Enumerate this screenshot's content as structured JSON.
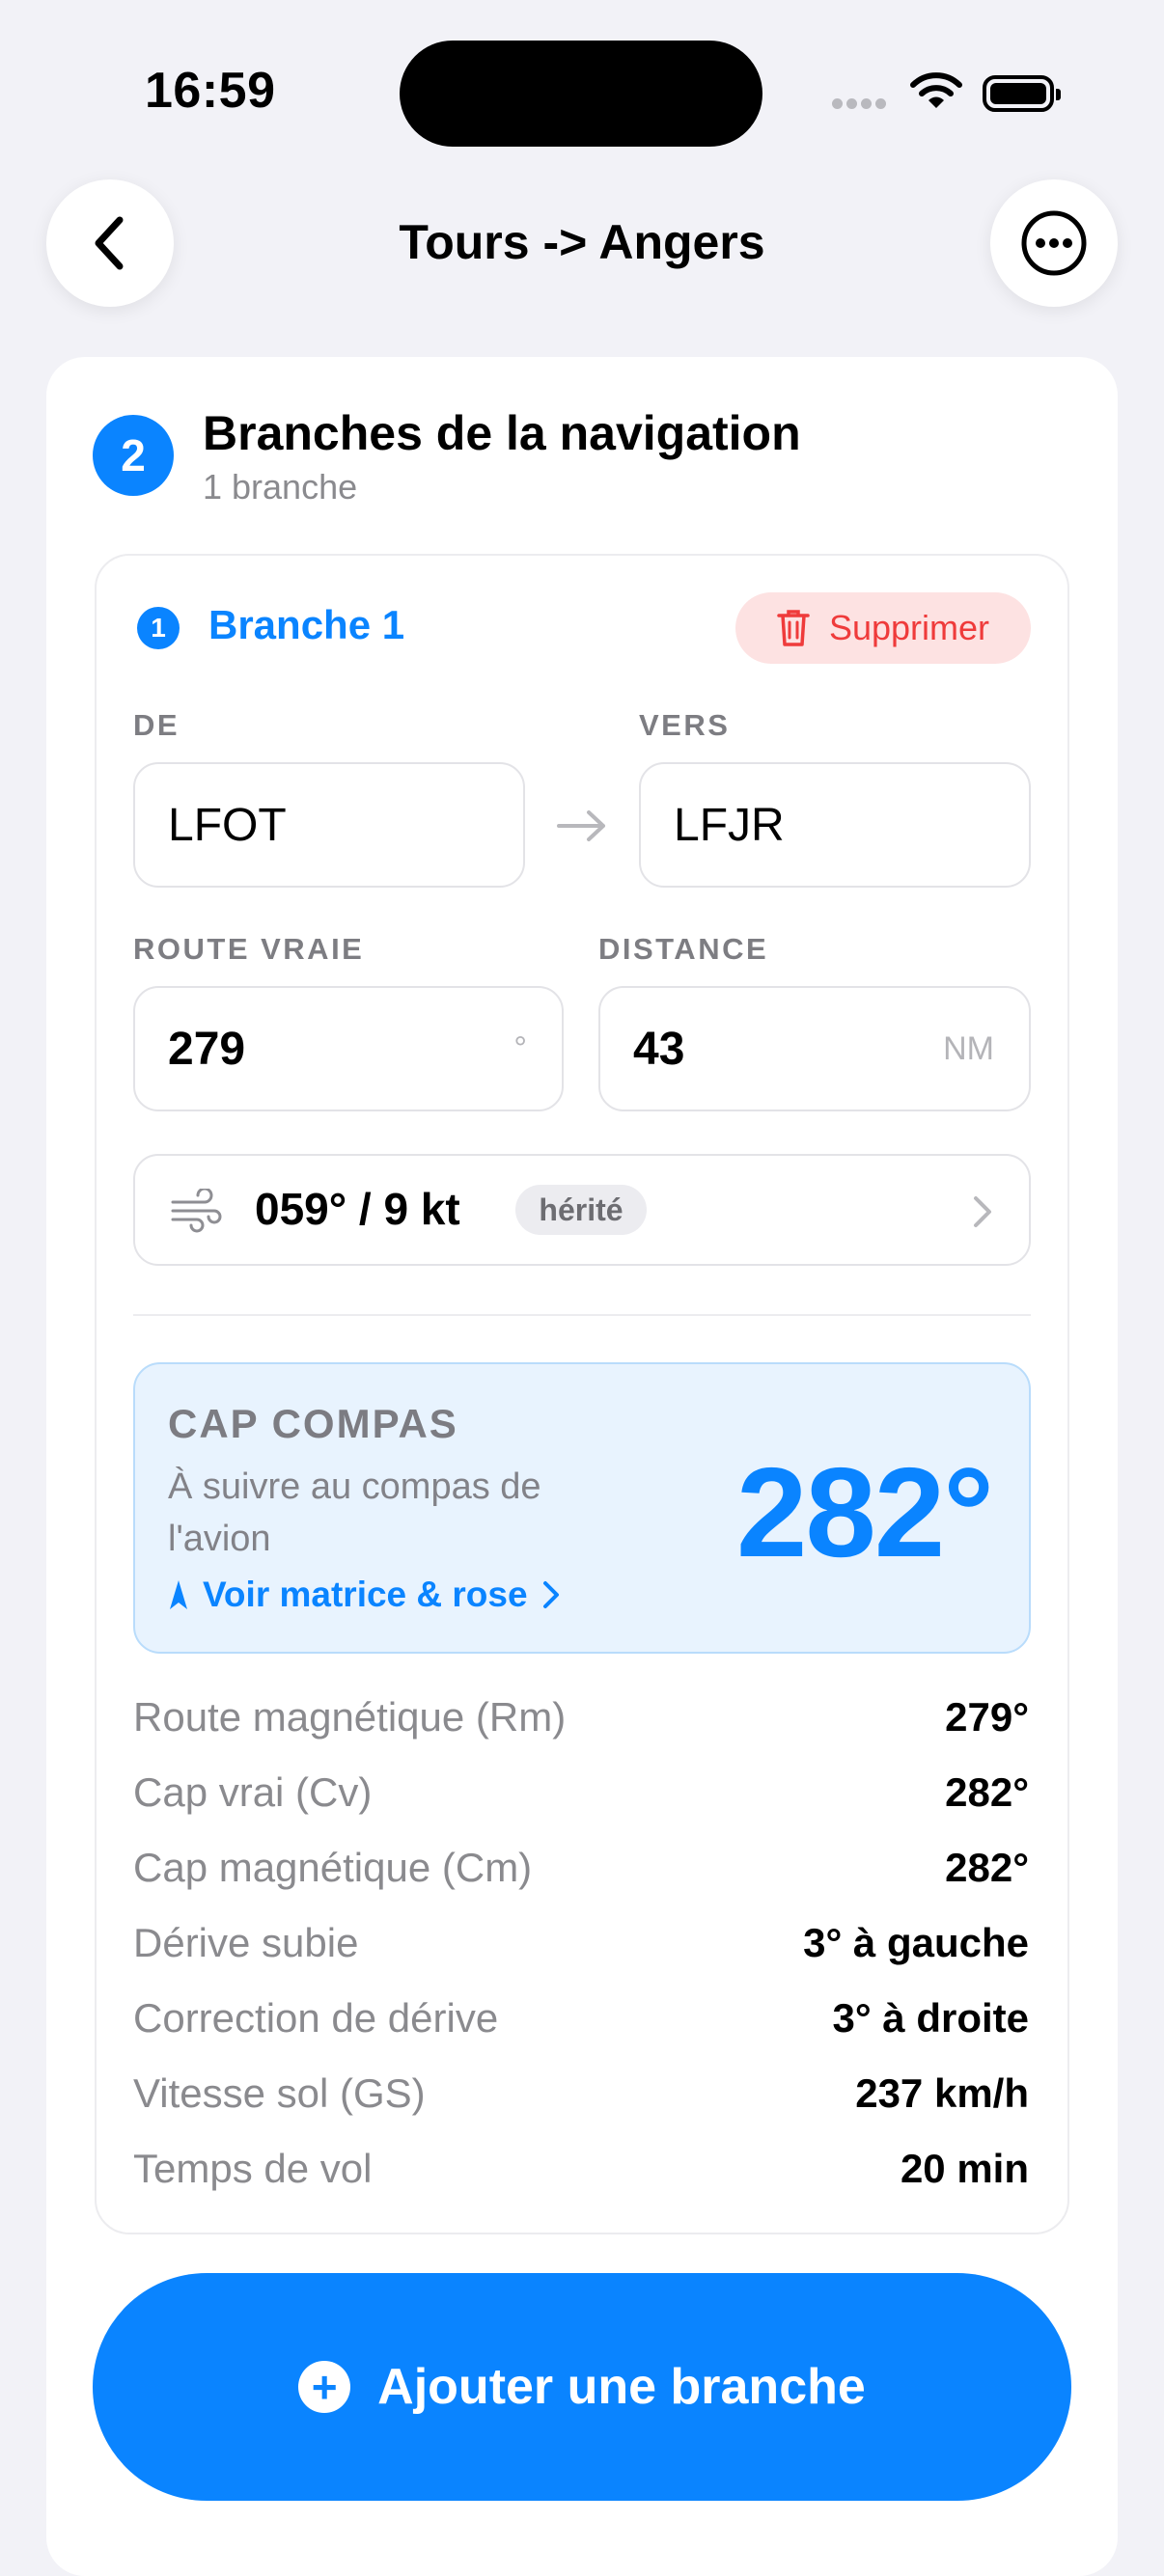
{
  "status": {
    "time": "16:59"
  },
  "header": {
    "title": "Tours -> Angers"
  },
  "section": {
    "step": "2",
    "title": "Branches de la navigation",
    "subtitle": "1 branche"
  },
  "branch": {
    "number": "1",
    "title": "Branche 1",
    "delete_label": "Supprimer",
    "from_label": "DE",
    "from_value": "LFOT",
    "to_label": "VERS",
    "to_value": "LFJR",
    "route_label": "ROUTE VRAIE",
    "route_value": "279",
    "route_unit": "°",
    "distance_label": "DISTANCE",
    "distance_value": "43",
    "distance_unit": "NM",
    "wind_value": "059° / 9 kt",
    "wind_badge": "hérité"
  },
  "compass": {
    "title": "CAP COMPAS",
    "subtitle": "À suivre au compas de l'avion",
    "link_label": "Voir matrice & rose",
    "value": "282°"
  },
  "results": [
    {
      "label": "Route magnétique (Rm)",
      "value": "279°"
    },
    {
      "label": "Cap vrai (Cv)",
      "value": "282°"
    },
    {
      "label": "Cap magnétique (Cm)",
      "value": "282°"
    },
    {
      "label": "Dérive subie",
      "value": "3° à gauche"
    },
    {
      "label": "Correction de dérive",
      "value": "3° à droite"
    },
    {
      "label": "Vitesse sol (GS)",
      "value": "237 km/h"
    },
    {
      "label": "Temps de vol",
      "value": "20 min"
    }
  ],
  "add_button": {
    "label": "Ajouter une branche"
  },
  "colors": {
    "accent": "#0a84ff",
    "danger": "#ef3b3b",
    "background": "#f2f2f7"
  }
}
